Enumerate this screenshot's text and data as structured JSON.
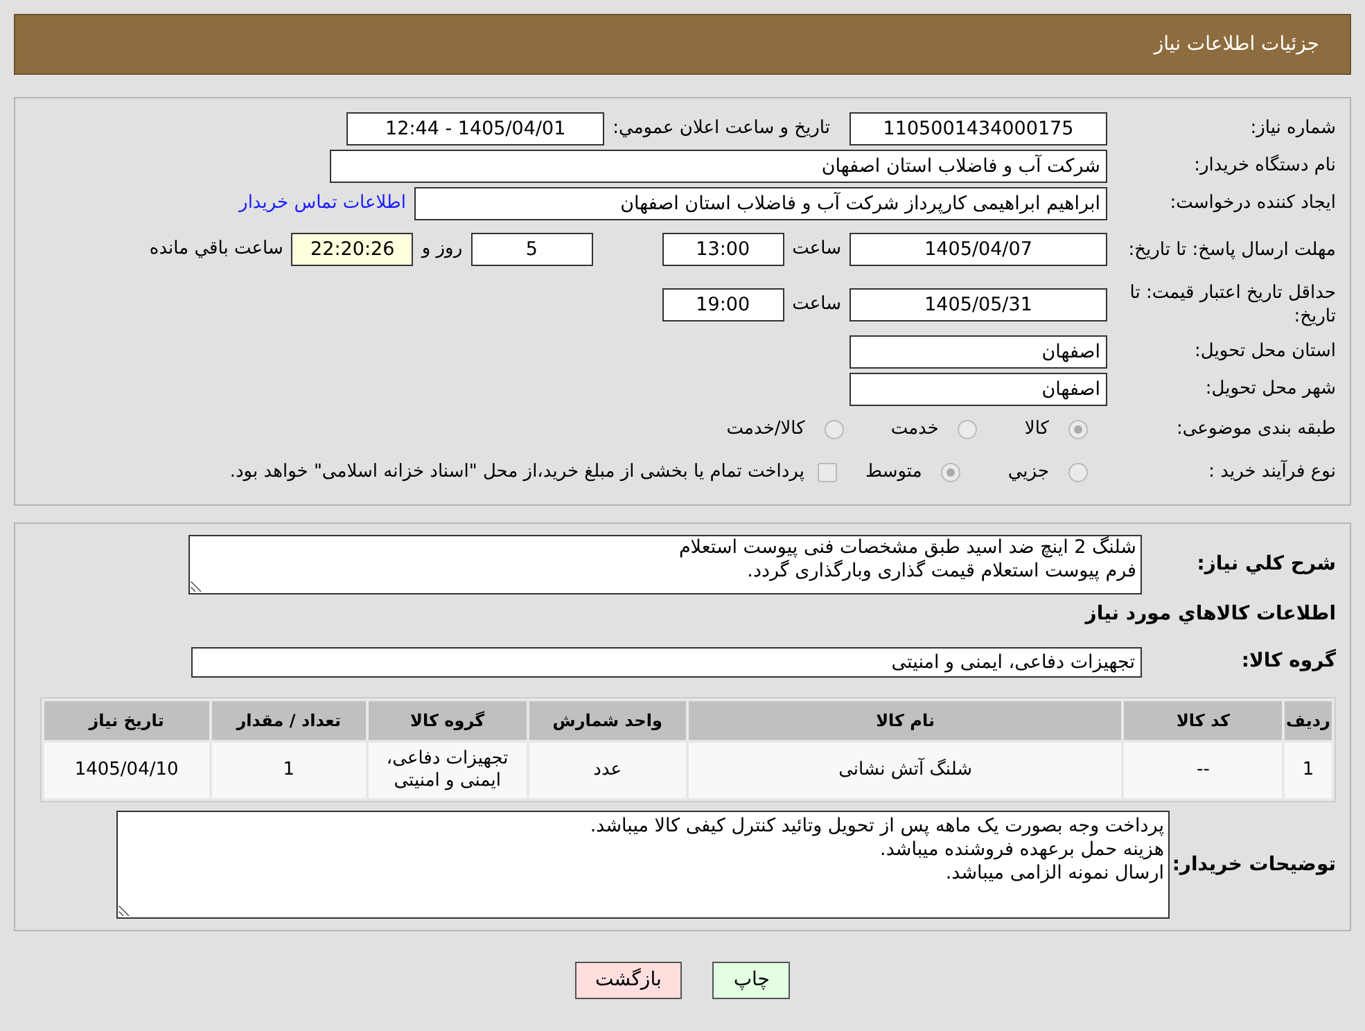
{
  "header": {
    "title": "جزئیات اطلاعات نیاز"
  },
  "details": {
    "need_number": {
      "label": "شماره نیاز:",
      "value": "1105001434000175"
    },
    "announce": {
      "label": "تاريخ و ساعت اعلان عمومي:",
      "value": "1405/04/01 - 12:44"
    },
    "buyer_org": {
      "label": "نام دستگاه خریدار:",
      "value": "شرکت آب و فاضلاب استان اصفهان"
    },
    "requester": {
      "label": "ایجاد کننده درخواست:",
      "value": "ابراهیم ابراهیمی کارپرداز شرکت آب و فاضلاب استان اصفهان",
      "link": "اطلاعات تماس خریدار"
    },
    "reply_deadline": {
      "label": "مهلت ارسال پاسخ: تا تاریخ:",
      "date": "1405/04/07",
      "time_label": "ساعت",
      "time": "13:00",
      "days": "5",
      "days_label": "روز و",
      "remaining": "22:20:26",
      "remaining_label": "ساعت باقي مانده"
    },
    "price_validity": {
      "label": "حداقل تاریخ اعتبار قیمت: تا تاریخ:",
      "date": "1405/05/31",
      "time_label": "ساعت",
      "time": "19:00"
    },
    "province": {
      "label": "استان محل تحویل:",
      "value": "اصفهان"
    },
    "city": {
      "label": "شهر محل تحویل:",
      "value": "اصفهان"
    },
    "category": {
      "label": "طبقه بندی موضوعی:",
      "options": [
        {
          "label": "کالا",
          "selected": true
        },
        {
          "label": "خدمت",
          "selected": false
        },
        {
          "label": "کالا/خدمت",
          "selected": false
        }
      ]
    },
    "process": {
      "label": "نوع فرآیند خرید :",
      "options": [
        {
          "label": "جزيي",
          "selected": false
        },
        {
          "label": "متوسط",
          "selected": true
        }
      ],
      "payment_checkbox": {
        "checked": false,
        "label": "پرداخت تمام یا بخشی از مبلغ خرید،از محل \"اسناد خزانه اسلامی\" خواهد بود."
      }
    }
  },
  "summary": {
    "description": {
      "label": "شرح کلي نياز:",
      "lines": [
        "شلنگ 2 اینچ ضد اسید طبق مشخصات فنی پیوست استعلام",
        "فرم پیوست استعلام قیمت گذاری وبارگذاری گردد."
      ]
    },
    "goods_heading": "اطلاعات کالاهاي مورد نياز",
    "goods_group": {
      "label": "گروه کالا:",
      "value": "تجهیزات دفاعی، ایمنی و امنیتی"
    },
    "table": {
      "columns": [
        "ردیف",
        "کد کالا",
        "نام کالا",
        "واحد شمارش",
        "گروه کالا",
        "تعداد / مقدار",
        "تاریخ نیاز"
      ],
      "rows": [
        [
          "1",
          "--",
          "شلنگ آتش نشانی",
          "عدد",
          "تجهیزات دفاعی، ایمنی و امنیتی",
          "1",
          "1405/04/10"
        ]
      ]
    },
    "buyer_notes": {
      "label": "توضیحات خریدار:",
      "lines": [
        "پرداخت وجه بصورت یک ماهه پس از تحویل وتائید کنترل کیفی کالا میباشد.",
        "هزینه حمل برعهده فروشنده میباشد.",
        "ارسال نمونه الزامی میباشد."
      ]
    }
  },
  "buttons": [
    {
      "label": "چاپ",
      "kind": "print"
    },
    {
      "label": "بازگشت",
      "kind": "back"
    }
  ]
}
